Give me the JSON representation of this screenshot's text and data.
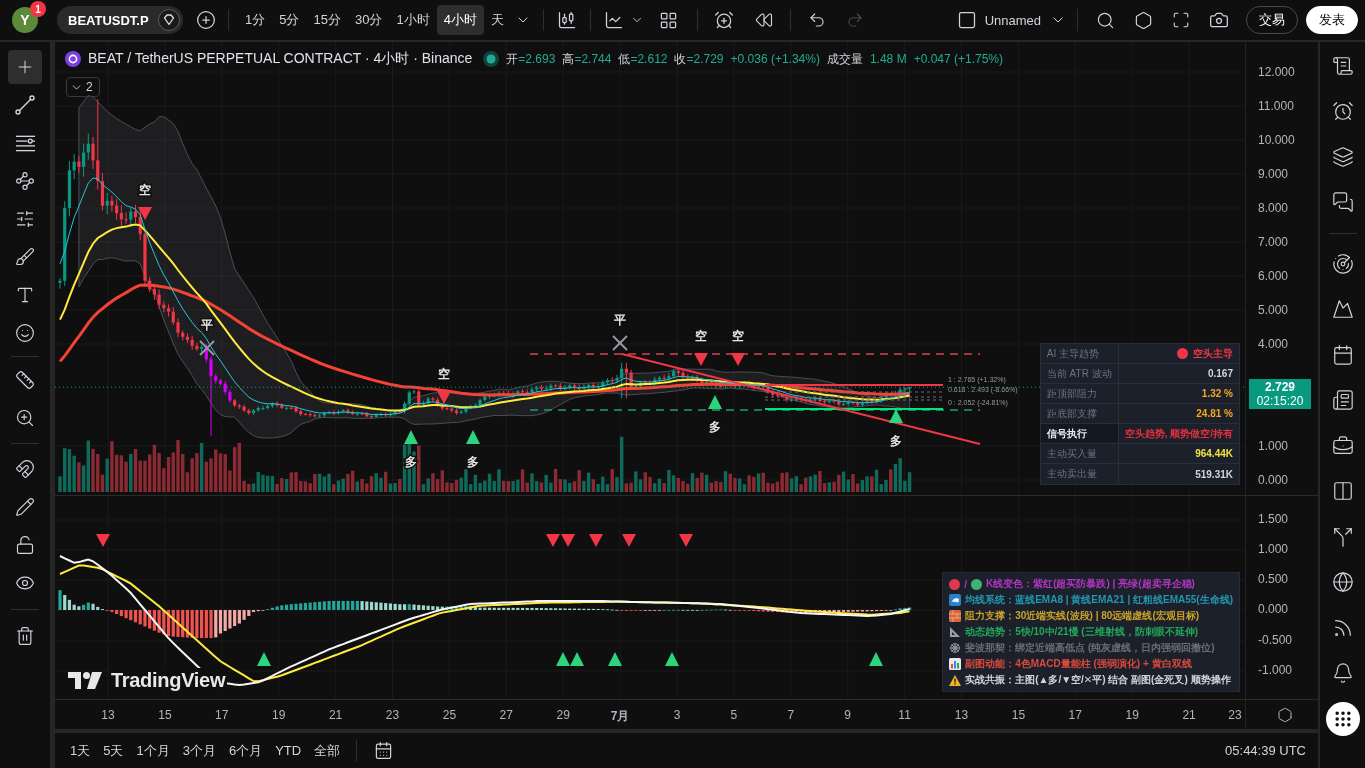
{
  "top_bar": {
    "avatar": {
      "letter": "Y",
      "badge": "1"
    },
    "symbol": "BEATUSDT.P",
    "intervals": [
      {
        "label": "1分",
        "selected": false
      },
      {
        "label": "5分",
        "selected": false
      },
      {
        "label": "15分",
        "selected": false
      },
      {
        "label": "30分",
        "selected": false
      },
      {
        "label": "1小时",
        "selected": false
      },
      {
        "label": "4小时",
        "selected": true
      },
      {
        "label": "天",
        "selected": false
      }
    ],
    "redo_enabled": false,
    "layout_name": "Unnamed",
    "buttons": [
      {
        "label": "交易",
        "kind": "outline"
      },
      {
        "label": "发表",
        "kind": "primary"
      }
    ]
  },
  "left_toolbar": {
    "tools": [
      {
        "selected": true
      },
      {
        "selected": false
      },
      {
        "selected": false
      },
      {
        "selected": false
      },
      {
        "selected": false
      },
      {
        "selected": false
      },
      {
        "selected": false
      },
      {
        "selected": false
      },
      {
        "selected": false
      },
      {
        "selected": false
      },
      {
        "selected": false
      },
      {
        "selected": false
      },
      {
        "selected": false
      },
      {
        "selected": false
      },
      {
        "selected": false
      }
    ]
  },
  "chart_legend": {
    "title": "BEAT / TetherUS PERPETUAL CONTRACT · 4小时 · Binance",
    "ohlc": [
      {
        "label": "开",
        "value": "=2.693"
      },
      {
        "label": "高",
        "value": "=2.744"
      },
      {
        "label": "低",
        "value": "=2.612"
      },
      {
        "label": "收",
        "value": "=2.729"
      }
    ],
    "change": "+0.036 (+1.34%)",
    "volume_label": "成交量",
    "volume": "1.48 M",
    "volume_change": "+0.047 (+1.75%)",
    "collapsed_count": "2"
  },
  "signals": [
    {
      "label": "空",
      "kind": "short"
    },
    {
      "label": "平",
      "kind": "close"
    },
    {
      "label": "多",
      "kind": "long"
    },
    {
      "label": "空",
      "kind": "short"
    },
    {
      "label": "多",
      "kind": "long"
    },
    {
      "label": "平",
      "kind": "close"
    },
    {
      "label": "空",
      "kind": "short"
    },
    {
      "label": "多",
      "kind": "long"
    },
    {
      "label": "空",
      "kind": "short"
    },
    {
      "label": "多",
      "kind": "long"
    }
  ],
  "fib_labels": [
    "1 : 2.765 (+1.32%)",
    "0.618 : 2.493 (-8.66%)",
    "0 : 2.052 (-24.81%)"
  ],
  "info_table": {
    "rows": [
      {
        "label": "AI 主导趋势",
        "value": "空头主导",
        "kind": "status",
        "color": "#f23645"
      },
      {
        "label": "当前 ATR 波动",
        "value": "0.167",
        "kind": "metric",
        "color": "#d1d4dc"
      },
      {
        "label": "距顶部阻力",
        "value": "1.32 %",
        "kind": "metric",
        "color": "#f5a623"
      },
      {
        "label": "距底部支撑",
        "value": "24.81 %",
        "kind": "metric",
        "color": "#f5a623"
      },
      {
        "label": "信号执行",
        "value": "空头趋势, 顺势做空/持有",
        "kind": "signal",
        "color": "#e0303f"
      },
      {
        "label": "主动买入量",
        "value": "964.44K",
        "kind": "metric",
        "color": "#f0e442"
      },
      {
        "label": "主动卖出量",
        "value": "519.31K",
        "kind": "metric",
        "color": "#d1d4dc"
      }
    ]
  },
  "price_axis": {
    "ticks": [
      "12.000",
      "11.000",
      "10.000",
      "9.000",
      "8.000",
      "7.000",
      "6.000",
      "5.000",
      "4.000",
      "1.000",
      "0.000"
    ],
    "last_price": "2.729",
    "countdown": "02:15:20"
  },
  "macd_axis": {
    "ticks": [
      "1.500",
      "1.000",
      "0.500",
      "0.000",
      "-0.500",
      "-1.000"
    ]
  },
  "indicator_notes": [
    {
      "kind": "candle_colors",
      "separator": "/",
      "text": "K线变色：紫红(超买防暴跌) | 亮绿(超卖寻企稳)",
      "color": "#b035c0"
    },
    {
      "kind": "averages",
      "text": "均线系统：蓝线EMA8 | 黄线EMA21 | 红粗线EMA55(生命线)",
      "color": "#2196b0"
    },
    {
      "kind": "levels",
      "text": "阻力支撑：30近端实线(波段) | 80远端虚线(宏观目标)",
      "color": "#c9a227"
    },
    {
      "kind": "trend",
      "text": "动态趋势：5快/10中/21慢 (三维射线，防刺眼不延伸)",
      "color": "#22a85a"
    },
    {
      "kind": "fibonacci",
      "text": "斐波那契：绑定近端高低点 (纯灰虚线，日内强弱回撤位)",
      "color": "#6b6e78"
    },
    {
      "kind": "momentum",
      "text": "副图动能：4色MACD量能柱 (强弱演化) + 黄白双线",
      "color": "#d94a3d"
    },
    {
      "kind": "summary",
      "text": "实战共振：主图(▲多/▼空/✕平) 结合 副图(金死叉) 顺势操作",
      "color": "#d1d4dc"
    }
  ],
  "brand": "TradingView",
  "time_axis": {
    "labels": [
      {
        "label": "13",
        "kind": "day"
      },
      {
        "label": "15",
        "kind": "day"
      },
      {
        "label": "17",
        "kind": "day"
      },
      {
        "label": "19",
        "kind": "day"
      },
      {
        "label": "21",
        "kind": "day"
      },
      {
        "label": "23",
        "kind": "day"
      },
      {
        "label": "25",
        "kind": "day"
      },
      {
        "label": "27",
        "kind": "day"
      },
      {
        "label": "29",
        "kind": "day"
      },
      {
        "label": "7月",
        "kind": "month"
      },
      {
        "label": "3",
        "kind": "day"
      },
      {
        "label": "5",
        "kind": "day"
      },
      {
        "label": "7",
        "kind": "day"
      },
      {
        "label": "9",
        "kind": "day"
      },
      {
        "label": "11",
        "kind": "day"
      },
      {
        "label": "13",
        "kind": "day"
      },
      {
        "label": "15",
        "kind": "day"
      },
      {
        "label": "17",
        "kind": "day"
      },
      {
        "label": "19",
        "kind": "day"
      },
      {
        "label": "21",
        "kind": "day"
      },
      {
        "label": "23",
        "kind": "day"
      }
    ]
  },
  "range_buttons": [
    "1天",
    "5天",
    "1个月",
    "3个月",
    "6个月",
    "YTD",
    "全部"
  ],
  "clock": "05:44:39 UTC"
}
